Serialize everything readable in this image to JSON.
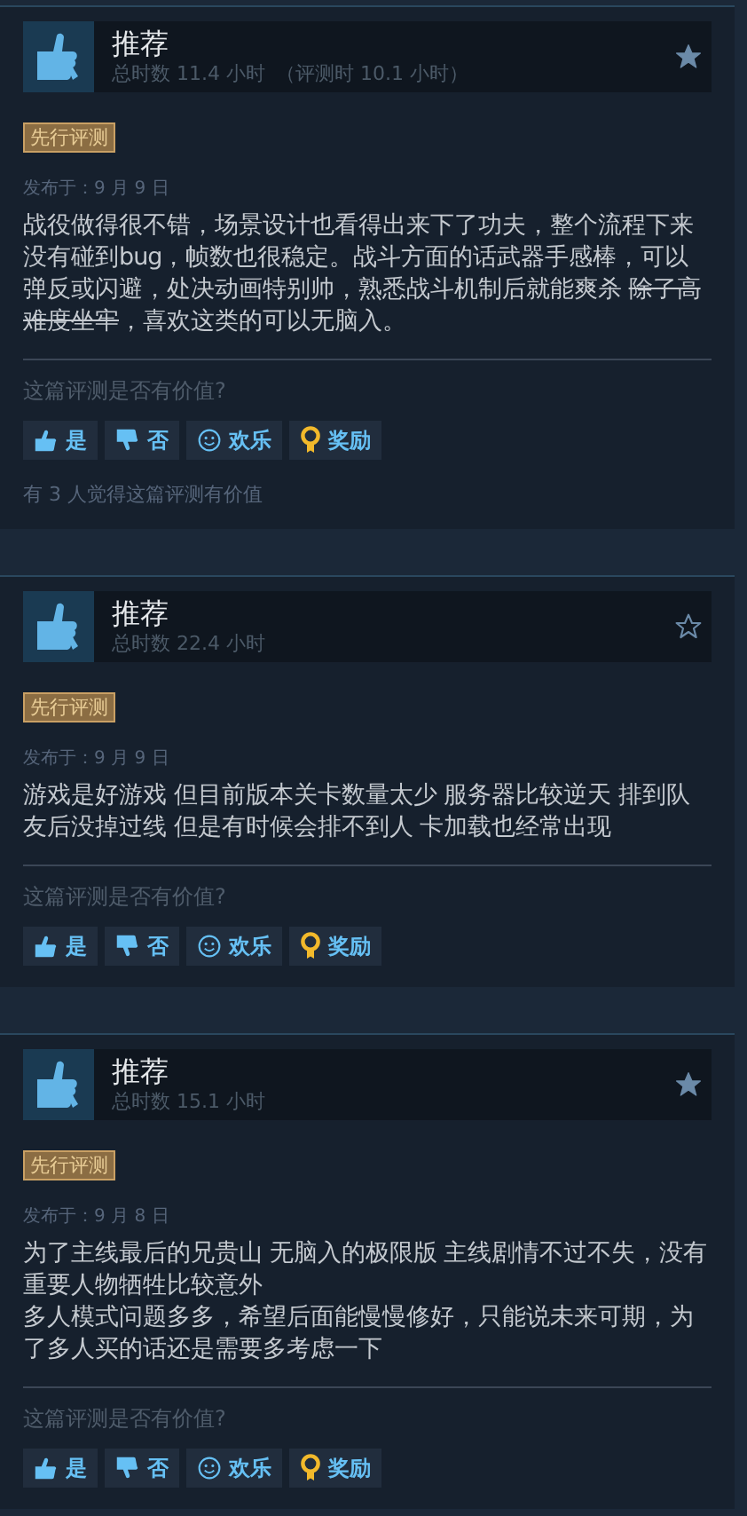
{
  "reviews": [
    {
      "verdict": "推荐",
      "playtime": "总时数 11.4 小时",
      "playtime_at_review": "（评测时 10.1 小时）",
      "starred": true,
      "badge": "先行评测",
      "posted": "发布于：9 月 9 日",
      "paragraphs": [
        [
          {
            "text": "战役做得很不错，场景设计也看得出来下了功夫，整个流程下来没有碰到bug，帧数也很稳定。战斗方面的话武器手感棒，可以弹反或闪避，处决动画特别帅，熟悉战斗机制后就能爽杀 ",
            "strike": false
          },
          {
            "text": "除了高难度坐牢",
            "strike": true
          },
          {
            "text": "，喜欢这类的可以无脑入。",
            "strike": false
          }
        ]
      ],
      "question": "这篇评测是否有价值?",
      "buttons": [
        {
          "kind": "yes",
          "label": "是"
        },
        {
          "kind": "no",
          "label": "否"
        },
        {
          "kind": "funny",
          "label": "欢乐"
        },
        {
          "kind": "award",
          "label": "奖励"
        }
      ],
      "helpful_count": "有 3 人觉得这篇评测有价值"
    },
    {
      "verdict": "推荐",
      "playtime": "总时数 22.4 小时",
      "starred": false,
      "badge": "先行评测",
      "posted": "发布于：9 月 9 日",
      "paragraphs": [
        [
          {
            "text": "游戏是好游戏 但目前版本关卡数量太少 服务器比较逆天 排到队友后没掉过线 但是有时候会排不到人 卡加载也经常出现",
            "strike": false
          }
        ]
      ],
      "question": "这篇评测是否有价值?",
      "buttons": [
        {
          "kind": "yes",
          "label": "是"
        },
        {
          "kind": "no",
          "label": "否"
        },
        {
          "kind": "funny",
          "label": "欢乐"
        },
        {
          "kind": "award",
          "label": "奖励"
        }
      ]
    },
    {
      "verdict": "推荐",
      "playtime": "总时数 15.1 小时",
      "starred": true,
      "badge": "先行评测",
      "posted": "发布于：9 月 8 日",
      "paragraphs": [
        [
          {
            "text": "为了主线最后的兄贵山 无脑入的极限版 主线剧情不过不失，没有重要人物牺牲比较意外",
            "strike": false
          }
        ],
        [
          {
            "text": "多人模式问题多多，希望后面能慢慢修好，只能说未来可期，为了多人买的话还是需要多考虑一下",
            "strike": false
          }
        ]
      ],
      "question": "这篇评测是否有价值?",
      "buttons": [
        {
          "kind": "yes",
          "label": "是"
        },
        {
          "kind": "no",
          "label": "否"
        },
        {
          "kind": "funny",
          "label": "欢乐"
        },
        {
          "kind": "award",
          "label": "奖励"
        }
      ]
    }
  ]
}
